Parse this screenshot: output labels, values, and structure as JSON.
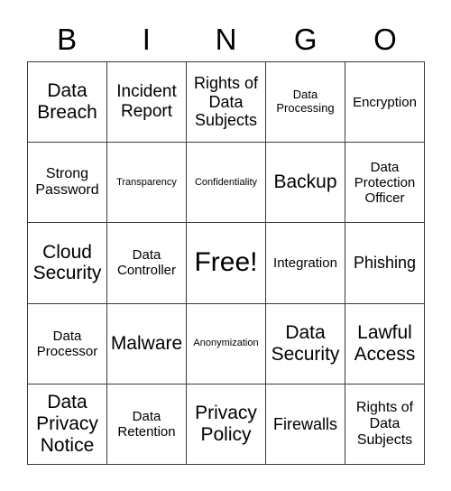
{
  "card": {
    "title": "Bingo Card",
    "header_letters": [
      "B",
      "I",
      "N",
      "G",
      "O"
    ],
    "columns": 5,
    "rows": 5,
    "free_space_label": "Free!",
    "colors": {
      "background": "#ffffff",
      "grid_line": "#3a3a3a",
      "text": "#000000"
    },
    "cells": [
      {
        "text": "Data Breach",
        "size": "xxl",
        "row": 1,
        "col": 1,
        "free": false
      },
      {
        "text": "Incident Report",
        "size": "xl",
        "row": 1,
        "col": 2,
        "free": false
      },
      {
        "text": "Rights of Data Subjects",
        "size": "l",
        "row": 1,
        "col": 3,
        "free": false
      },
      {
        "text": "Data Processing",
        "size": "s",
        "row": 1,
        "col": 4,
        "free": false
      },
      {
        "text": "Encryption",
        "size": "m",
        "row": 1,
        "col": 5,
        "free": false
      },
      {
        "text": "Strong Password",
        "size": "ml",
        "row": 2,
        "col": 1,
        "free": false
      },
      {
        "text": "Transparency",
        "size": "xs",
        "row": 2,
        "col": 2,
        "free": false
      },
      {
        "text": "Confidentiality",
        "size": "xs",
        "row": 2,
        "col": 3,
        "free": false
      },
      {
        "text": "Backup",
        "size": "xxl",
        "row": 2,
        "col": 4,
        "free": false
      },
      {
        "text": "Data Protection Officer",
        "size": "m",
        "row": 2,
        "col": 5,
        "free": false
      },
      {
        "text": "Cloud Security",
        "size": "xxl",
        "row": 3,
        "col": 1,
        "free": false
      },
      {
        "text": "Data Controller",
        "size": "m",
        "row": 3,
        "col": 2,
        "free": false
      },
      {
        "text": "Free!",
        "size": "free",
        "row": 3,
        "col": 3,
        "free": true
      },
      {
        "text": "Integration",
        "size": "m",
        "row": 3,
        "col": 4,
        "free": false
      },
      {
        "text": "Phishing",
        "size": "l",
        "row": 3,
        "col": 5,
        "free": false
      },
      {
        "text": "Data Processor",
        "size": "m",
        "row": 4,
        "col": 1,
        "free": false
      },
      {
        "text": "Malware",
        "size": "xxl",
        "row": 4,
        "col": 2,
        "free": false
      },
      {
        "text": "Anonymization",
        "size": "xs",
        "row": 4,
        "col": 3,
        "free": false
      },
      {
        "text": "Data Security",
        "size": "xxl",
        "row": 4,
        "col": 4,
        "free": false
      },
      {
        "text": "Lawful Access",
        "size": "xxl",
        "row": 4,
        "col": 5,
        "free": false
      },
      {
        "text": "Data Privacy Notice",
        "size": "xxl",
        "row": 5,
        "col": 1,
        "free": false
      },
      {
        "text": "Data Retention",
        "size": "m",
        "row": 5,
        "col": 2,
        "free": false
      },
      {
        "text": "Privacy Policy",
        "size": "xxl",
        "row": 5,
        "col": 3,
        "free": false
      },
      {
        "text": "Firewalls",
        "size": "l",
        "row": 5,
        "col": 4,
        "free": false
      },
      {
        "text": "Rights of Data Subjects",
        "size": "ml",
        "row": 5,
        "col": 5,
        "free": false
      }
    ]
  }
}
